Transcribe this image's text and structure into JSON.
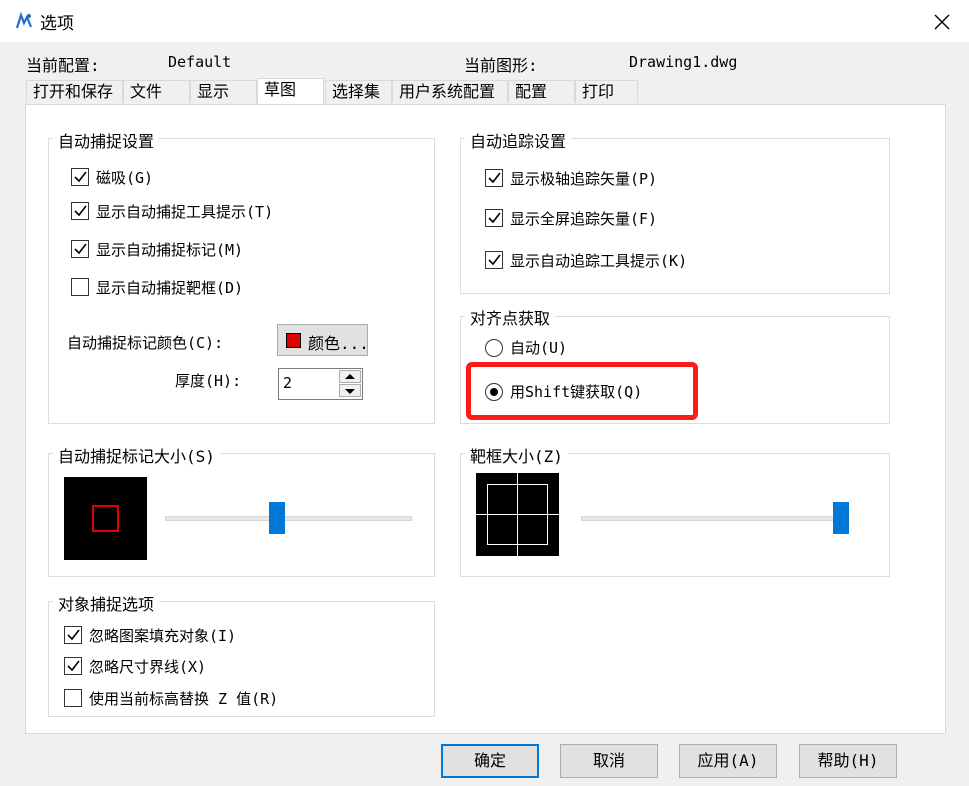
{
  "window": {
    "title": "选项"
  },
  "header": {
    "profile_label": "当前配置:",
    "profile_value": "Default",
    "drawing_label": "当前图形:",
    "drawing_value": "Drawing1.dwg"
  },
  "tabs": [
    "打开和保存",
    "文件",
    "显示",
    "草图",
    "选择集",
    "用户系统配置",
    "配置",
    "打印"
  ],
  "active_tab": "草图",
  "autosnap": {
    "title": "自动捕捉设置",
    "items": [
      {
        "label": "磁吸(G)",
        "checked": true
      },
      {
        "label": "显示自动捕捉工具提示(T)",
        "checked": true
      },
      {
        "label": "显示自动捕捉标记(M)",
        "checked": true
      },
      {
        "label": "显示自动捕捉靶框(D)",
        "checked": false
      }
    ],
    "color_label": "自动捕捉标记颜色(C):",
    "color_button": "颜色...",
    "color_value": "#e00000",
    "thickness_label": "厚度(H):",
    "thickness_value": "2"
  },
  "autotrack": {
    "title": "自动追踪设置",
    "items": [
      {
        "label": "显示极轴追踪矢量(P)",
        "checked": true
      },
      {
        "label": "显示全屏追踪矢量(F)",
        "checked": true
      },
      {
        "label": "显示自动追踪工具提示(K)",
        "checked": true
      }
    ]
  },
  "alignment": {
    "title": "对齐点获取",
    "options": [
      {
        "label": "自动(U)",
        "selected": false
      },
      {
        "label": "用Shift键获取(Q)",
        "selected": true
      }
    ],
    "highlight_color": "#ff1a1a"
  },
  "marker_size": {
    "title": "自动捕捉标记大小(S)",
    "level": 0.45
  },
  "aperture_size": {
    "title": "靶框大小(Z)",
    "level": 1.0
  },
  "object_snap": {
    "title": "对象捕捉选项",
    "items": [
      {
        "label": "忽略图案填充对象(I)",
        "checked": true
      },
      {
        "label": "忽略尺寸界线(X)",
        "checked": true
      },
      {
        "label": "使用当前标高替换 Z 值(R)",
        "checked": false
      }
    ]
  },
  "buttons": {
    "ok": "确定",
    "cancel": "取消",
    "apply": "应用(A)",
    "help": "帮助(H)"
  },
  "colors": {
    "accent": "#0078d7",
    "panel_bg": "#ffffff",
    "window_bg": "#f0f0f0"
  }
}
